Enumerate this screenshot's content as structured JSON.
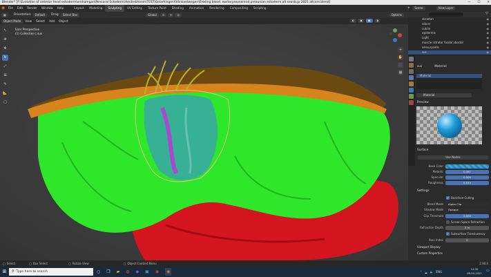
{
  "titlebar": {
    "title": "Blender* [F:\\Evolution of anterior head ectoderm\\ernhamgan\\Pencoral Ectoderm\\Amitrebhonm\\TEST\\Gelarhingen\\\\Vlinkardwegen\\Eroding blood. ewrterprevnerend preaunian ectoderm alt seonb.jp 2021 allcore.blend]",
    "min": "—",
    "max": "☐",
    "close": "✕"
  },
  "menubar": {
    "menus": [
      "File",
      "Edit",
      "Render",
      "Window",
      "Help"
    ],
    "workspaces": [
      "Layout",
      "Modeling",
      "Sculpting",
      "UV Editing",
      "Texture Paint",
      "Shading",
      "Animation",
      "Rendering",
      "Compositing",
      "Scripting"
    ],
    "active_workspace": "Sculpting",
    "scene_label": "Scene",
    "view_layer_label": "View Layer"
  },
  "header": {
    "orientation_label": "Orientation:",
    "orientation_value": "Default",
    "drag_label": "Drag:",
    "drag_value": "Select Box",
    "transform_value": "Global",
    "options_label": "Options"
  },
  "header2": {
    "mode": "Object Mode",
    "menus": [
      "View",
      "Select",
      "Add",
      "Object"
    ]
  },
  "viewport": {
    "perspective": "User Perspective",
    "collection": "(1) Collection | sus"
  },
  "outliner": {
    "items": [
      {
        "label": "skeleton"
      },
      {
        "label": "vibcer"
      },
      {
        "label": "cutcle"
      },
      {
        "label": "epidermis"
      },
      {
        "label": "Light"
      },
      {
        "label": "muscle retrator fosdal vbecklr"
      },
      {
        "label": "sensurycells"
      },
      {
        "label": "sus"
      }
    ],
    "selected_index": 7
  },
  "properties": {
    "slot_label": "sus",
    "slot_field": "Material",
    "material_list": [
      "Material"
    ],
    "material_name": "Material",
    "preview_title": "Preview",
    "surface_title": "Surface",
    "surface_type": "Use Nodes",
    "rows": [
      {
        "label": "Base Color",
        "value": ""
      },
      {
        "label": "Metallic",
        "value": "0.467"
      },
      {
        "label": "Specular",
        "value": "0.500"
      },
      {
        "label": "Roughness",
        "value": "0.513"
      }
    ],
    "settings_title": "Settings",
    "backface_label": "Backface Culling",
    "blend_mode_label": "Blend Mode",
    "blend_mode_value": "Alpha Clip",
    "shadow_mode_label": "Shadow Mode",
    "shadow_mode_value": "Opaque",
    "clip_threshold_label": "Clip Threshold",
    "clip_threshold_value": "0.500",
    "screen_refraction_label": "Screen Space Refraction",
    "refraction_depth_label": "Refraction Depth",
    "refraction_depth_value": "0 m",
    "subsurface_label": "Subsurface Translucency",
    "pass_index_label": "Pass Index",
    "pass_index_value": "0",
    "viewport_display": "Viewport Display",
    "custom_properties": "Custom Properties"
  },
  "statusbar": {
    "select": "Select",
    "box_select": "Box Select",
    "rotate_view": "Rotate View",
    "context_menu": "Object Context Menu",
    "version": "2.90.0"
  },
  "taskbar": {
    "search_placeholder": "Type here to search",
    "lang": "ENG",
    "time": "14:30",
    "date": "08.04.2021"
  },
  "colors": {
    "accent": "#4772b3",
    "mesh_green": "#2ee62a",
    "mesh_red": "#d4141e",
    "mesh_brown": "#6b4a12",
    "mesh_orange": "#d8841c"
  }
}
